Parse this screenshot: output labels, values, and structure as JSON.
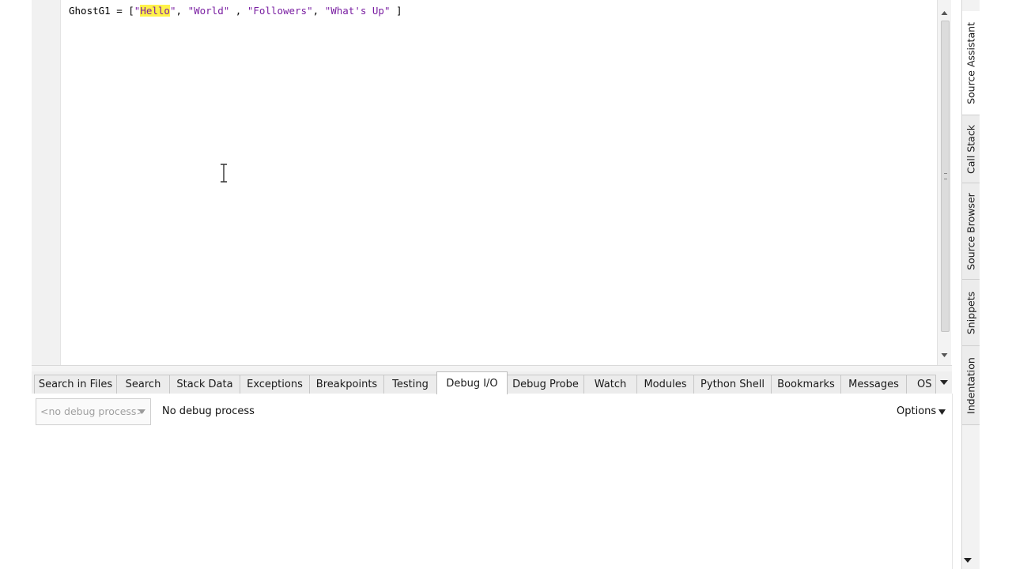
{
  "editor": {
    "code": {
      "var": "GhostG1",
      "op": " = [",
      "s1_open": "\"",
      "s1_hl": "Hello",
      "s1_close": "\"",
      "sep1": ", ",
      "s2": "\"World\"",
      "sep2": " , ",
      "s3": "\"Followers\"",
      "sep3": ", ",
      "s4": "\"What's Up\"",
      "end": " ]"
    }
  },
  "bottom_tabs": {
    "items": [
      {
        "label": "Search in Files"
      },
      {
        "label": "Search"
      },
      {
        "label": "Stack Data"
      },
      {
        "label": "Exceptions"
      },
      {
        "label": "Breakpoints"
      },
      {
        "label": "Testing"
      },
      {
        "label": "Debug I/O"
      },
      {
        "label": "Debug Probe"
      },
      {
        "label": "Watch"
      },
      {
        "label": "Modules"
      },
      {
        "label": "Python Shell"
      },
      {
        "label": "Bookmarks"
      },
      {
        "label": "Messages"
      },
      {
        "label": "OS"
      }
    ],
    "active": "Debug I/O"
  },
  "debug_io": {
    "process_select": "<no debug process>",
    "status": "No debug process",
    "options_label": "Options"
  },
  "right_tools": {
    "items": [
      {
        "label": "Source Assistant",
        "active": true
      },
      {
        "label": "Call Stack"
      },
      {
        "label": "Source Browser"
      },
      {
        "label": "Snippets"
      },
      {
        "label": "Indentation"
      }
    ]
  },
  "colors": {
    "string": "#7a1fa2",
    "highlight": "#fff24a"
  }
}
